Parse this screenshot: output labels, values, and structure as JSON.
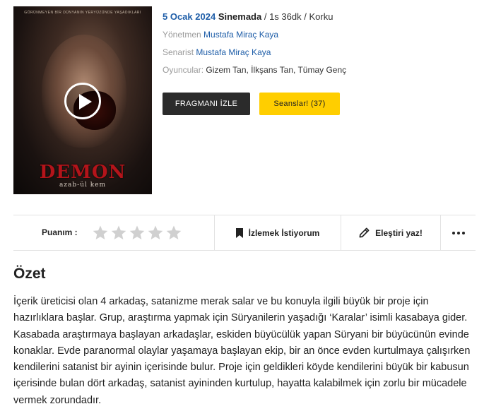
{
  "poster": {
    "tagline": "GÖRÜNMEYEN BİR DÜNYANIN YERYÜZÜNDE YAŞADIKLARI",
    "title": "DEMON",
    "subtitle": "azab-ül kem"
  },
  "movie": {
    "date": "5 Ocak 2024",
    "status": "Sinemada",
    "sep1": " / ",
    "duration": "1s 36dk",
    "sep2": " / ",
    "genre": "Korku",
    "director_label": "Yönetmen",
    "director": "Mustafa Miraç Kaya",
    "writer_label": "Senarist",
    "writer": "Mustafa Miraç Kaya",
    "cast_label": "Oyuncular:",
    "cast": "Gizem Tan, İlkşans Tan, Tümay Genç"
  },
  "buttons": {
    "trailer": "FRAGMANI İZLE",
    "sessions": "Seanslar! (37)"
  },
  "actions": {
    "rating_label": "Puanım :",
    "rating_value": 0,
    "rating_max": 5,
    "watchlist": "İzlemek İstiyorum",
    "review": "Eleştiri yaz!"
  },
  "summary": {
    "title": "Özet",
    "text": "İçerik üreticisi olan 4 arkadaş, satanizme merak salar ve bu konuyla ilgili büyük bir proje için hazırlıklara başlar. Grup, araştırma yapmak için Süryanilerin yaşadığı ‘Karalar’ isimli kasabaya gider. Kasabada araştırmaya başlayan arkadaşlar, eskiden büyücülük yapan Süryani bir büyücünün evinde konaklar. Evde paranormal olaylar yaşamaya başlayan ekip, bir an önce evden kurtulmaya çalışırken kendilerini satanist bir ayinin içerisinde bulur. Proje için geldikleri köyde kendilerini büyük bir kabusun içerisinde bulan dört arkadaş, satanist ayininden kurtulup, hayatta kalabilmek için zorlu bir mücadele vermek zorundadır."
  },
  "colors": {
    "link": "#1f5ea8",
    "sessions_button": "#ffce00",
    "trailer_button": "#2b2b2b",
    "star_empty": "#d0d0d0"
  },
  "icons": {
    "play": "play-icon",
    "bookmark": "bookmark-icon",
    "pencil": "pencil-icon",
    "more": "more-dots-icon",
    "star": "star-icon"
  }
}
